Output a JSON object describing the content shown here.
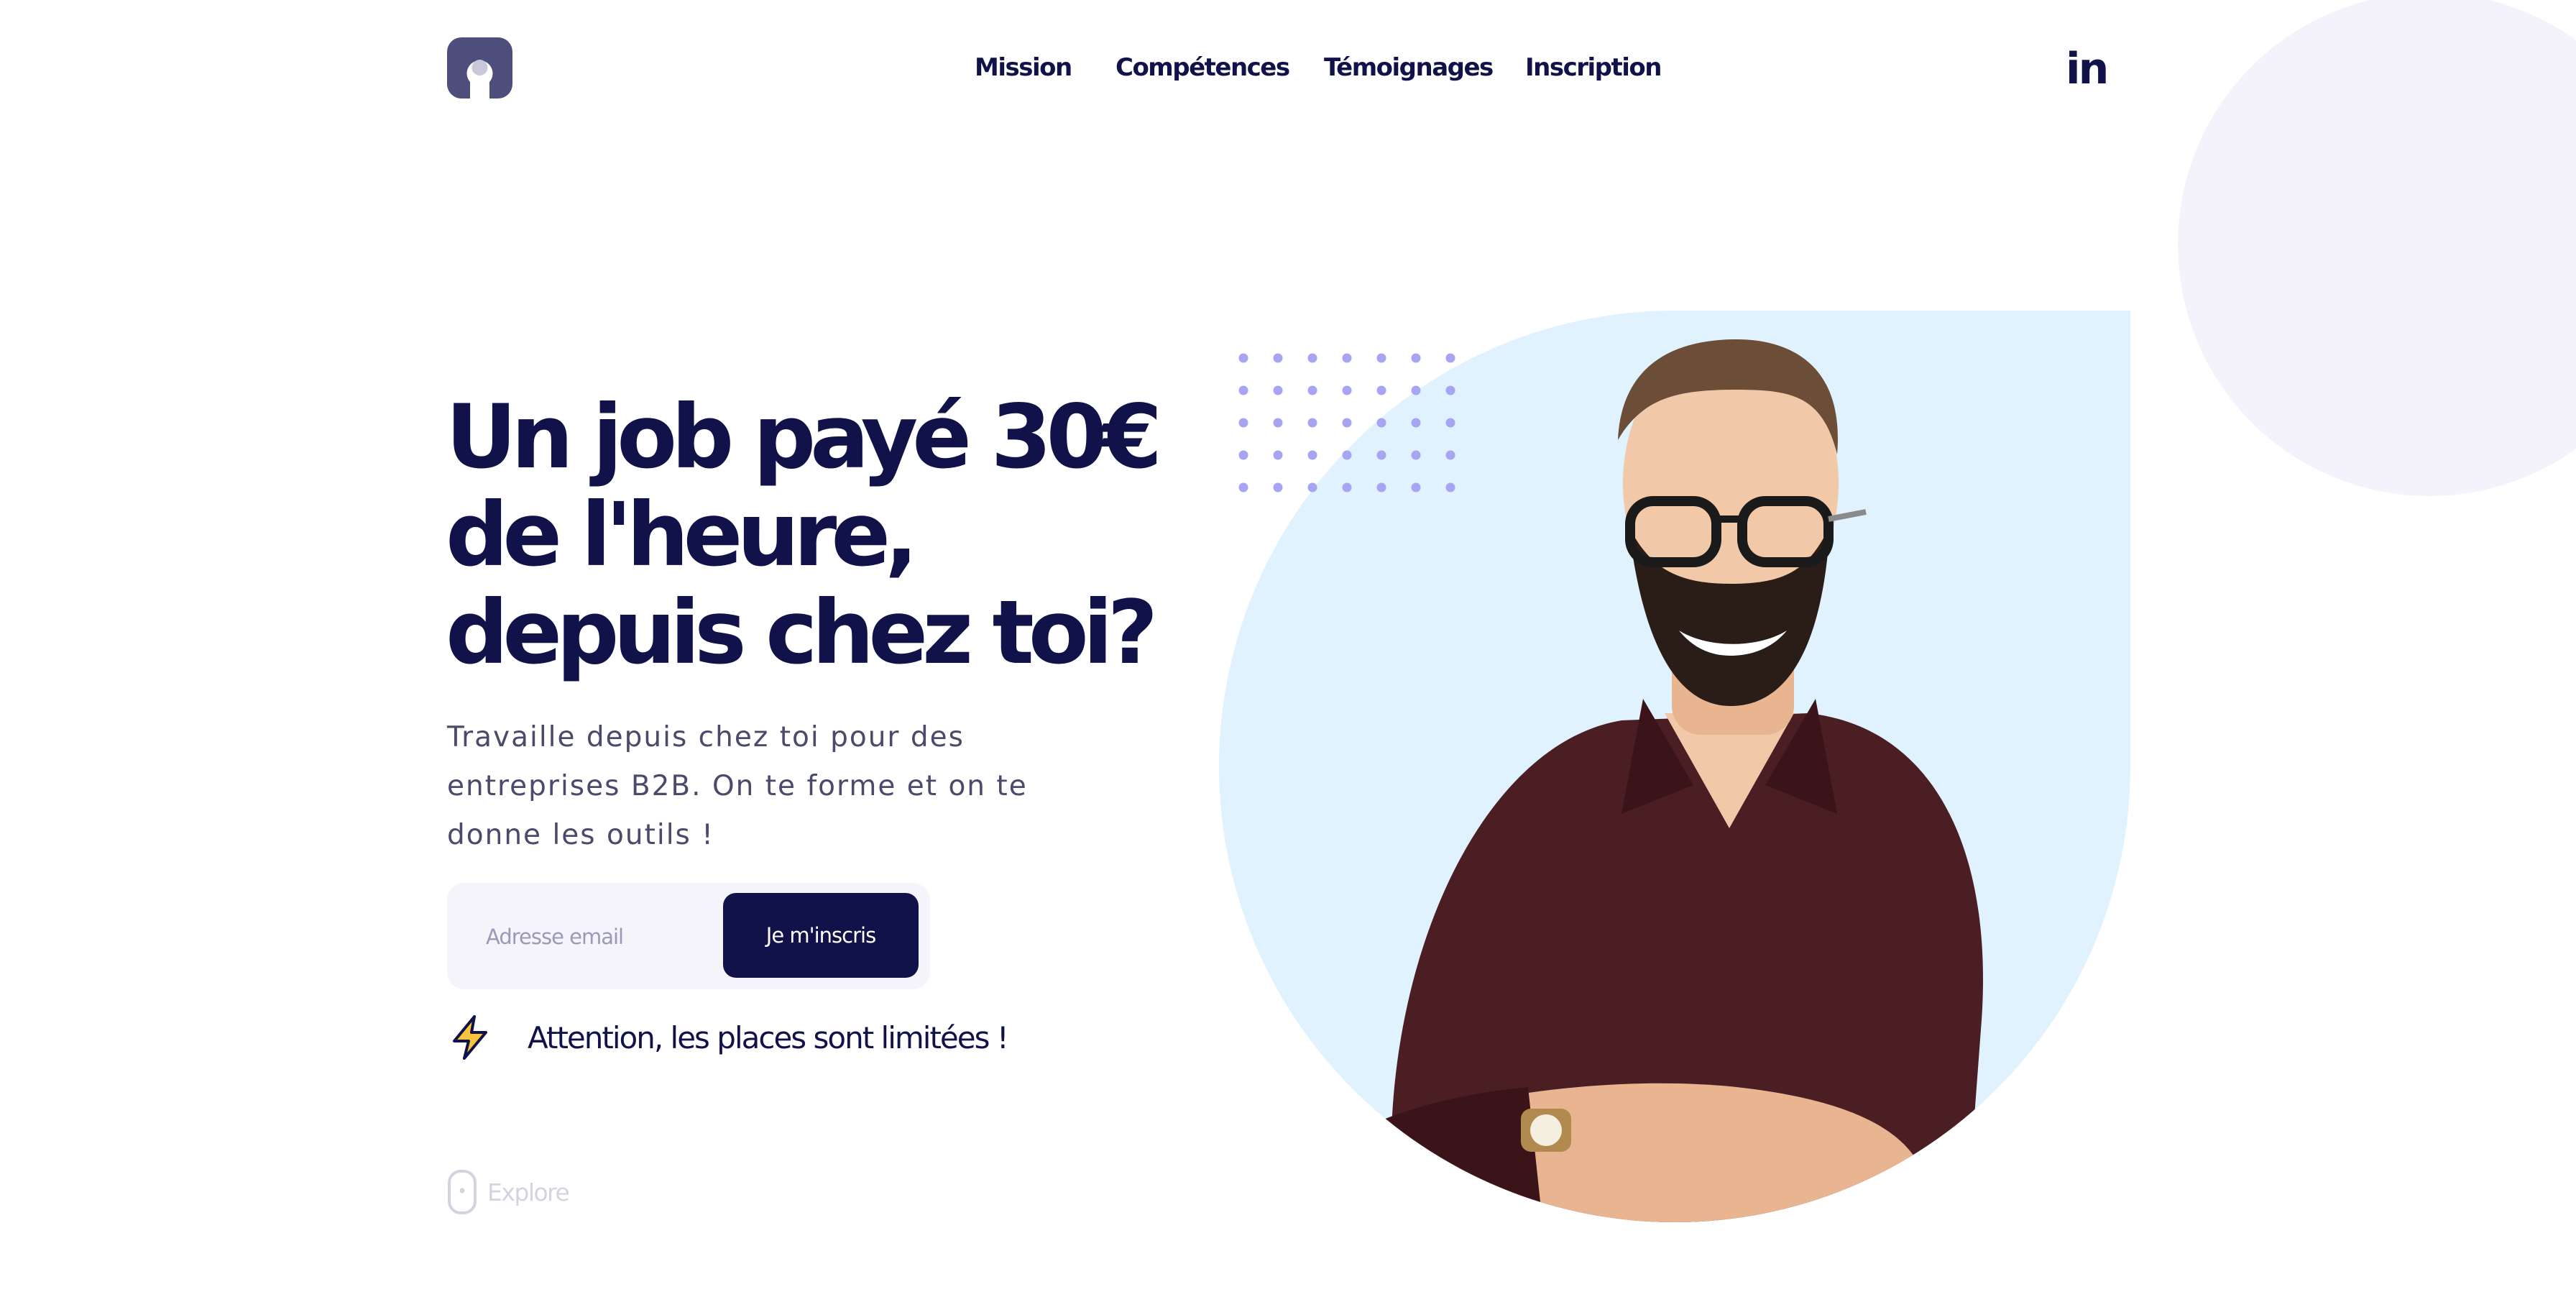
{
  "nav": {
    "items": [
      {
        "label": "Mission"
      },
      {
        "label": "Compétences"
      },
      {
        "label": "Témoignages"
      },
      {
        "label": "Inscription"
      }
    ],
    "social": {
      "label": "in",
      "icon": "linkedin-icon"
    }
  },
  "hero": {
    "title": "Un job payé 30€ de l'heure, depuis chez toi?",
    "subtitle": "Travaille depuis chez toi pour des entreprises B2B. On te forme et on te donne les outils !"
  },
  "signup": {
    "email_placeholder": "Adresse email",
    "button_label": "Je m'inscris"
  },
  "warning": {
    "icon": "lightning-icon",
    "text": "Attention, les places sont limitées !"
  },
  "explore": {
    "icon": "mouse-icon",
    "label": "Explore"
  },
  "colors": {
    "navy": "#12124a",
    "light_blue": "#dff2fd",
    "lavender": "#f4f3fc",
    "dot_purple": "#a8a4f4",
    "bolt_yellow": "#f8c43a"
  }
}
